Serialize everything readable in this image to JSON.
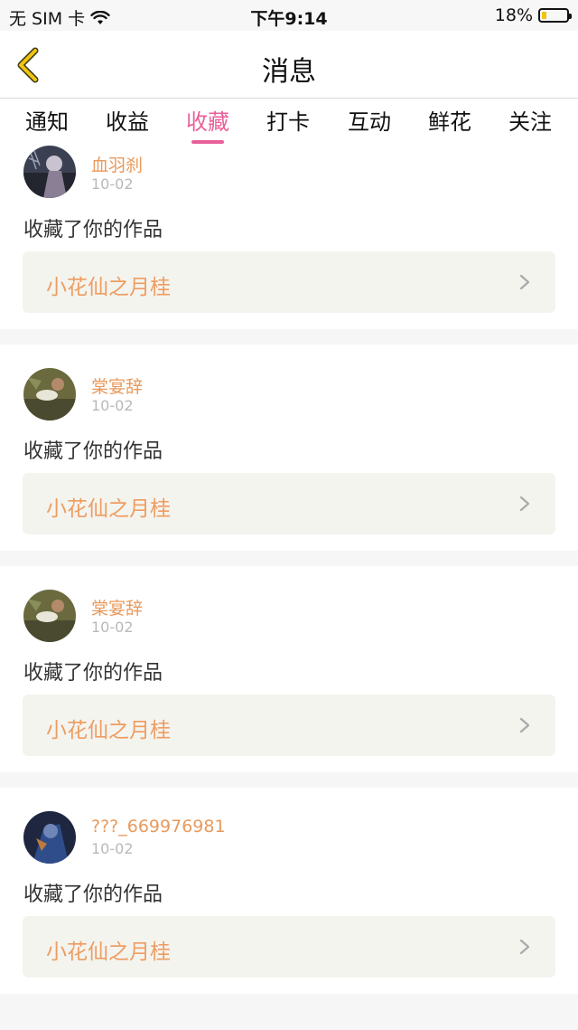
{
  "status_bar": {
    "carrier": "无 SIM 卡",
    "time": "下午9:14",
    "battery": "18%",
    "battery_level": 0.18
  },
  "header": {
    "title": "消息"
  },
  "tabs": [
    {
      "label": "通知"
    },
    {
      "label": "收益"
    },
    {
      "label": "收藏",
      "active": true
    },
    {
      "label": "打卡"
    },
    {
      "label": "互动"
    },
    {
      "label": "鲜花"
    },
    {
      "label": "关注"
    }
  ],
  "items": [
    {
      "user": "血羽刹",
      "date": "10-02",
      "action": "收藏了你的作品",
      "work": "小花仙之月桂"
    },
    {
      "user": "棠宴辞",
      "date": "10-02",
      "action": "收藏了你的作品",
      "work": "小花仙之月桂"
    },
    {
      "user": "棠宴辞",
      "date": "10-02",
      "action": "收藏了你的作品",
      "work": "小花仙之月桂"
    },
    {
      "user": "???_669976981",
      "date": "10-02",
      "action": "收藏了你的作品",
      "work": "小花仙之月桂"
    }
  ],
  "colors": {
    "accent": "#e8609a",
    "username": "#e89a5d",
    "work_title": "#ee9d62",
    "back_arrow": "#f1c40f"
  }
}
